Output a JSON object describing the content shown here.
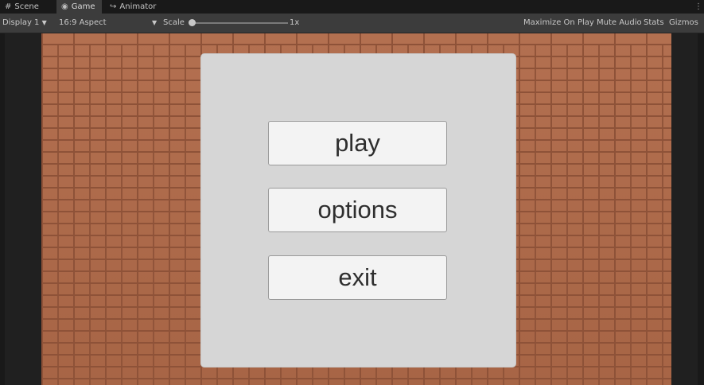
{
  "tabs": [
    {
      "label": "Scene",
      "icon": "grid-icon",
      "active": false
    },
    {
      "label": "Game",
      "icon": "gamepad-icon",
      "active": true
    },
    {
      "label": "Animator",
      "icon": "animator-icon",
      "active": false
    }
  ],
  "toolbar": {
    "display": "Display 1",
    "aspect": "16:9 Aspect",
    "scale_label": "Scale",
    "scale_value": "1x",
    "scale_level": 0.0,
    "maximize": "Maximize On Play",
    "mute": "Mute Audio",
    "stats": "Stats",
    "gizmos": "Gizmos"
  },
  "menu": {
    "play": "play",
    "options": "options",
    "exit": "exit"
  },
  "colors": {
    "brick": "#b06a49",
    "mortar": "#8e5238",
    "panel": "#d6d6d6",
    "button": "#f3f3f3"
  }
}
